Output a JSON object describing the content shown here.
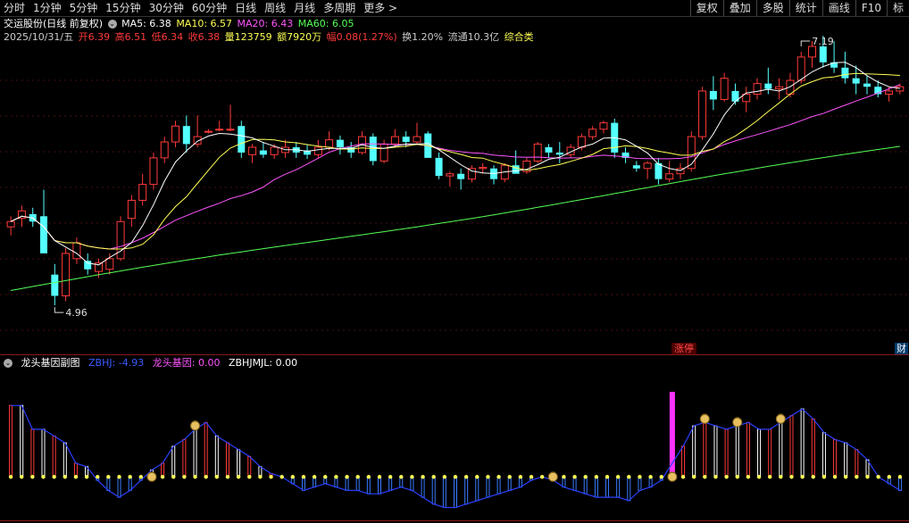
{
  "toolbar": {
    "periods": [
      "分时",
      "1分钟",
      "5分钟",
      "15分钟",
      "30分钟",
      "60分钟",
      "日线",
      "周线",
      "月线",
      "多周期",
      "更多 >"
    ],
    "tools": [
      "复权",
      "叠加",
      "多股",
      "统计",
      "画线",
      "F10",
      "标"
    ]
  },
  "header": {
    "name": "交运股份(日线 前复权)",
    "ma5": "MA5: 6.38",
    "ma10": "MA10: 6.57",
    "ma20": "MA20: 6.43",
    "ma60": "MA60: 6.05",
    "date": "2025/10/31/五",
    "open": "开6.39",
    "high": "高6.51",
    "low": "低6.34",
    "close": "收6.38",
    "vol": "量123759",
    "amount": "额7920万",
    "change": "幅0.08(1.27%)",
    "turnover": "换1.20%",
    "float": "流通10.3亿",
    "sector": "综合类"
  },
  "indicator": {
    "name": "龙头基因副图",
    "zbhj": "ZBHJ: -4.93",
    "gene": "龙头基因: 0.00",
    "jmjl": "ZBHJMJL: 0.00"
  },
  "tags": {
    "zt": "涨停",
    "cai": "财"
  },
  "colors": {
    "up": "#ff3a3a",
    "down": "#54ffff",
    "ma5": "#ffffff",
    "ma10": "#ffff55",
    "ma20": "#ff55ff",
    "ma60": "#55ff55"
  },
  "chart_data": [
    {
      "type": "candlestick",
      "series": [
        {
          "name": "OHLC",
          "values": [
            [
              5.7,
              5.8,
              5.62,
              5.75
            ],
            [
              5.78,
              5.9,
              5.7,
              5.85
            ],
            [
              5.82,
              5.88,
              5.7,
              5.75
            ],
            [
              5.8,
              6.05,
              5.5,
              5.45
            ],
            [
              5.25,
              5.35,
              4.96,
              5.05
            ],
            [
              5.05,
              5.5,
              5.0,
              5.45
            ],
            [
              5.4,
              5.6,
              5.35,
              5.55
            ],
            [
              5.38,
              5.45,
              5.25,
              5.3
            ],
            [
              5.28,
              5.4,
              5.22,
              5.36
            ],
            [
              5.3,
              5.45,
              5.25,
              5.4
            ],
            [
              5.4,
              5.8,
              5.38,
              5.75
            ],
            [
              5.78,
              6.0,
              5.7,
              5.95
            ],
            [
              5.95,
              6.2,
              5.9,
              6.1
            ],
            [
              6.1,
              6.4,
              6.05,
              6.35
            ],
            [
              6.35,
              6.55,
              6.3,
              6.5
            ],
            [
              6.5,
              6.7,
              6.45,
              6.65
            ],
            [
              6.65,
              6.75,
              6.4,
              6.48
            ],
            [
              6.48,
              6.75,
              6.45,
              6.55
            ],
            [
              6.6,
              6.62,
              6.58,
              6.6
            ],
            [
              6.62,
              6.7,
              6.6,
              6.62
            ],
            [
              6.62,
              6.85,
              6.6,
              6.62
            ],
            [
              6.65,
              6.7,
              6.35,
              6.4
            ],
            [
              6.38,
              6.48,
              6.3,
              6.45
            ],
            [
              6.42,
              6.5,
              6.35,
              6.38
            ],
            [
              6.38,
              6.48,
              6.34,
              6.45
            ],
            [
              6.4,
              6.52,
              6.35,
              6.45
            ],
            [
              6.45,
              6.5,
              6.35,
              6.4
            ],
            [
              6.42,
              6.48,
              6.34,
              6.38
            ],
            [
              6.38,
              6.52,
              6.35,
              6.45
            ],
            [
              6.45,
              6.6,
              6.42,
              6.52
            ],
            [
              6.52,
              6.56,
              6.38,
              6.45
            ],
            [
              6.45,
              6.5,
              6.35,
              6.4
            ],
            [
              6.4,
              6.6,
              6.38,
              6.55
            ],
            [
              6.55,
              6.58,
              6.28,
              6.32
            ],
            [
              6.32,
              6.52,
              6.3,
              6.48
            ],
            [
              6.48,
              6.62,
              6.45,
              6.55
            ],
            [
              6.55,
              6.6,
              6.45,
              6.5
            ],
            [
              6.5,
              6.68,
              6.48,
              6.55
            ],
            [
              6.58,
              6.6,
              6.38,
              6.35
            ],
            [
              6.35,
              6.4,
              6.15,
              6.18
            ],
            [
              6.18,
              6.22,
              6.08,
              6.2
            ],
            [
              6.2,
              6.25,
              6.05,
              6.15
            ],
            [
              6.15,
              6.28,
              6.12,
              6.25
            ],
            [
              6.25,
              6.3,
              6.2,
              6.26
            ],
            [
              6.25,
              6.28,
              6.1,
              6.15
            ],
            [
              6.15,
              6.3,
              6.12,
              6.28
            ],
            [
              6.28,
              6.42,
              6.22,
              6.2
            ],
            [
              6.22,
              6.35,
              6.2,
              6.32
            ],
            [
              6.32,
              6.5,
              6.3,
              6.48
            ],
            [
              6.45,
              6.48,
              6.35,
              6.4
            ],
            [
              6.4,
              6.5,
              6.3,
              6.38
            ],
            [
              6.38,
              6.48,
              6.35,
              6.45
            ],
            [
              6.45,
              6.58,
              6.42,
              6.55
            ],
            [
              6.55,
              6.65,
              6.52,
              6.62
            ],
            [
              6.62,
              6.7,
              6.58,
              6.68
            ],
            [
              6.68,
              6.72,
              6.35,
              6.4
            ],
            [
              6.4,
              6.45,
              6.3,
              6.35
            ],
            [
              6.28,
              6.32,
              6.22,
              6.25
            ],
            [
              6.25,
              6.32,
              6.15,
              6.3
            ],
            [
              6.3,
              6.35,
              6.1,
              6.15
            ],
            [
              6.15,
              6.32,
              6.12,
              6.2
            ],
            [
              6.2,
              6.3,
              6.15,
              6.25
            ],
            [
              6.25,
              6.6,
              6.22,
              6.55
            ],
            [
              6.55,
              7.02,
              6.52,
              6.98
            ],
            [
              6.98,
              7.12,
              6.8,
              6.9
            ],
            [
              6.9,
              7.15,
              6.88,
              7.1
            ],
            [
              6.98,
              7.05,
              6.85,
              6.88
            ],
            [
              6.88,
              7.02,
              6.78,
              6.95
            ],
            [
              6.95,
              7.1,
              6.9,
              7.05
            ],
            [
              7.05,
              7.2,
              6.95,
              7.0
            ],
            [
              7.0,
              7.1,
              6.9,
              7.02
            ],
            [
              6.95,
              7.15,
              6.92,
              7.08
            ],
            [
              7.08,
              7.35,
              7.05,
              7.3
            ],
            [
              7.3,
              7.45,
              7.2,
              7.4
            ],
            [
              7.4,
              7.5,
              7.2,
              7.25
            ],
            [
              7.25,
              7.45,
              7.15,
              7.2
            ],
            [
              7.2,
              7.35,
              7.05,
              7.1
            ],
            [
              7.1,
              7.22,
              6.95,
              7.05
            ],
            [
              7.05,
              7.12,
              6.95,
              7.02
            ],
            [
              7.02,
              7.08,
              6.92,
              6.95
            ],
            [
              6.95,
              7.02,
              6.88,
              6.98
            ],
            [
              6.98,
              7.05,
              6.95,
              7.02
            ]
          ]
        }
      ],
      "moving_averages": [
        "MA5",
        "MA10",
        "MA20",
        "MA60"
      ],
      "annotations": [
        {
          "label": "4.96"
        },
        {
          "label": "7.19"
        }
      ],
      "ylim": [
        4.6,
        7.4
      ]
    },
    {
      "type": "bar",
      "series": [
        {
          "name": "ZBHJ",
          "values": [
            21,
            21,
            14,
            14,
            12,
            10,
            4,
            3,
            -1,
            -4,
            -6,
            -4,
            -1,
            2,
            4,
            9,
            11,
            14,
            16,
            12,
            10,
            8,
            6,
            3,
            1,
            0,
            -2,
            -4,
            -3,
            -2,
            -3,
            -4,
            -4,
            -5,
            -5,
            -4,
            -3,
            -4,
            -6,
            -8,
            -9,
            -9,
            -8,
            -7,
            -6,
            -5,
            -4,
            -3,
            -1,
            0,
            -1,
            -3,
            -4,
            -5,
            -6,
            -6,
            -6,
            -7,
            -4,
            -3,
            -1,
            4,
            9,
            15,
            16,
            15,
            14,
            15,
            16,
            14,
            14,
            16,
            18,
            20,
            17,
            13,
            11,
            10,
            8,
            5,
            0,
            -2,
            -4
          ]
        },
        {
          "name": "龙头基因",
          "values": [
            0,
            0,
            0,
            0,
            0,
            0,
            0,
            0,
            0,
            0,
            0,
            0,
            0,
            0,
            0,
            0,
            0,
            0,
            0,
            0,
            0,
            0,
            0,
            0,
            0,
            0,
            0,
            0,
            0,
            0,
            0,
            0,
            0,
            0,
            0,
            0,
            0,
            0,
            0,
            0,
            0,
            0,
            0,
            0,
            0,
            0,
            0,
            0,
            0,
            0,
            0,
            0,
            0,
            0,
            0,
            0,
            0,
            0,
            0,
            0,
            0,
            25,
            0,
            0,
            0,
            0,
            0,
            0,
            0,
            0,
            0,
            0,
            0,
            0,
            0,
            0,
            0,
            0,
            0,
            0,
            0,
            0,
            0
          ]
        }
      ],
      "ylim": [
        -12,
        30
      ]
    }
  ]
}
